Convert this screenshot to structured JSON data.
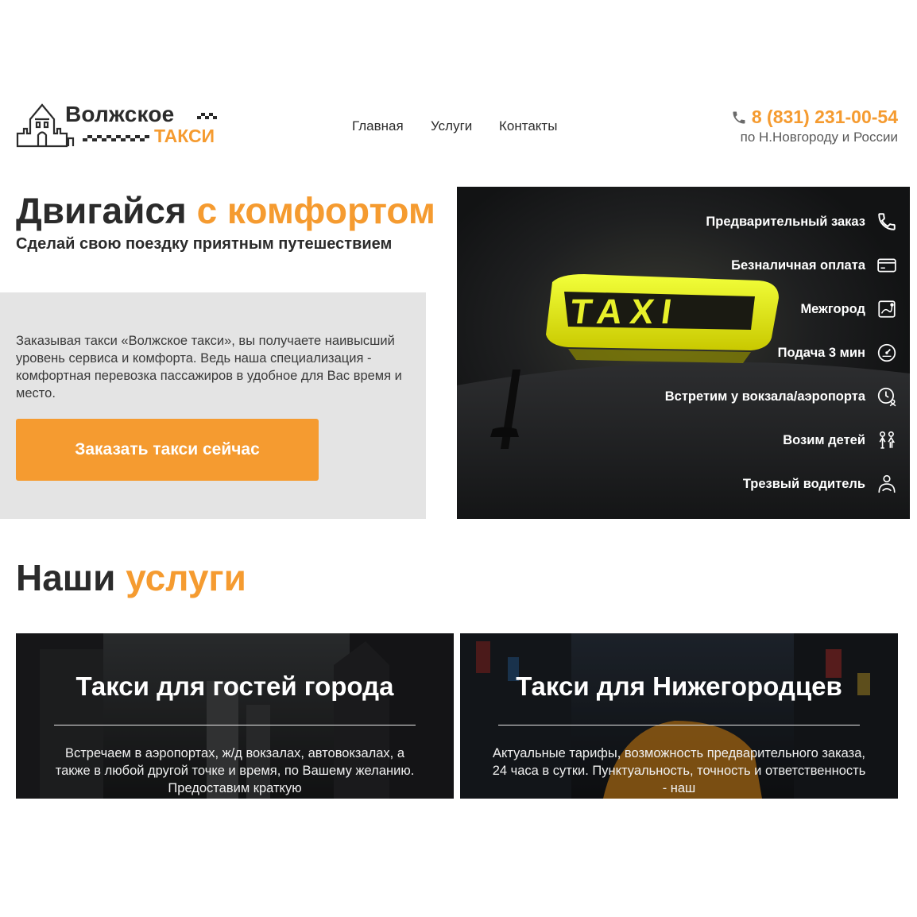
{
  "header": {
    "logo": {
      "line1": "Волжское",
      "line2": "ТАКСИ"
    },
    "nav": [
      {
        "label": "Главная"
      },
      {
        "label": "Услуги"
      },
      {
        "label": "Контакты"
      }
    ],
    "phone": {
      "number": "8 (831) 231-00-54",
      "subtitle": "по Н.Новгороду и России",
      "icon": "phone-icon"
    }
  },
  "hero": {
    "title_part1": "Двигайся ",
    "title_accent": "с комфортом",
    "subtitle": "Сделай свою поездку приятным путешествием",
    "description": "Заказывая такси «Волжское такси», вы получаете наивысший уровень сервиса и комфорта. Ведь наша специализация - комфортная перевозка пассажиров в удобное для Вас время и место.",
    "button_label": "Заказать такси сейчас",
    "sign_text": "TAXI",
    "features": [
      {
        "label": "Предварительный заказ",
        "icon": "phone-icon"
      },
      {
        "label": "Безналичная оплата",
        "icon": "credit-card-icon"
      },
      {
        "label": "Межгород",
        "icon": "map-route-icon"
      },
      {
        "label": "Подача 3 мин",
        "icon": "speedometer-icon"
      },
      {
        "label": "Встретим у вокзала/аэропорта",
        "icon": "clock-person-icon"
      },
      {
        "label": "Возим детей",
        "icon": "children-icon"
      },
      {
        "label": "Трезвый водитель",
        "icon": "driver-icon"
      }
    ]
  },
  "services": {
    "title_part1": "Наши ",
    "title_accent": "услуги",
    "cards": [
      {
        "title": "Такси для гостей города",
        "text": "Встречаем в аэропортах, ж/д вокзалах, автовокзалах, а также в любой другой точке и время, по Вашему желанию. Предоставим краткую"
      },
      {
        "title": "Такси для Нижегородцев",
        "text": "Актуальные тарифы, возможность предварительного заказа, 24 часа в сутки. Пунктуальность, точность и ответственность - наш"
      }
    ]
  },
  "colors": {
    "accent": "#f59b30",
    "text": "#2b2b2b",
    "panel": "#e4e4e4"
  }
}
